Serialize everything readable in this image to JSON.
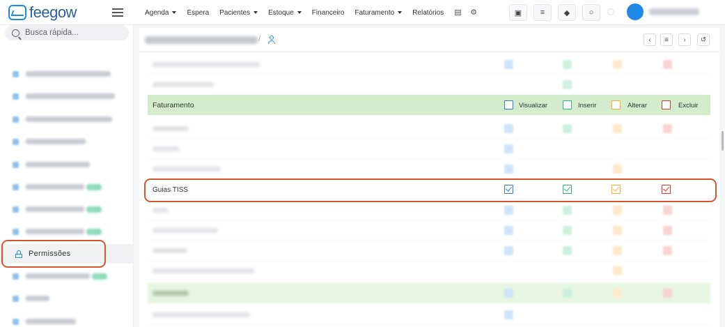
{
  "brand": {
    "name": "feegow",
    "color": "#1e88e5"
  },
  "topnav": {
    "items": [
      {
        "label": "Agenda",
        "dropdown": true
      },
      {
        "label": "Espera",
        "dropdown": false
      },
      {
        "label": "Pacientes",
        "dropdown": true
      },
      {
        "label": "Estoque",
        "dropdown": true
      },
      {
        "label": "Financeiro",
        "dropdown": false
      },
      {
        "label": "Faturamento",
        "dropdown": true
      },
      {
        "label": "Relatórios",
        "dropdown": false
      }
    ]
  },
  "sidebar": {
    "search_placeholder": "Busca rápida...",
    "active_item": "Permissões"
  },
  "permissions": {
    "group_label": "Faturamento",
    "columns": [
      "Visualizar",
      "Inserir",
      "Alterar",
      "Excluir"
    ],
    "highlighted_row": {
      "label": "Guias TISS",
      "visualizar": true,
      "inserir": true,
      "alterar": true,
      "excluir": true
    }
  },
  "colors": {
    "visualizar": "#2d7cc1",
    "inserir": "#36b37e",
    "alterar": "#f3b532",
    "excluir": "#cf3f3a",
    "group_bg": "#d4eccb",
    "highlight": "#d9532f"
  }
}
